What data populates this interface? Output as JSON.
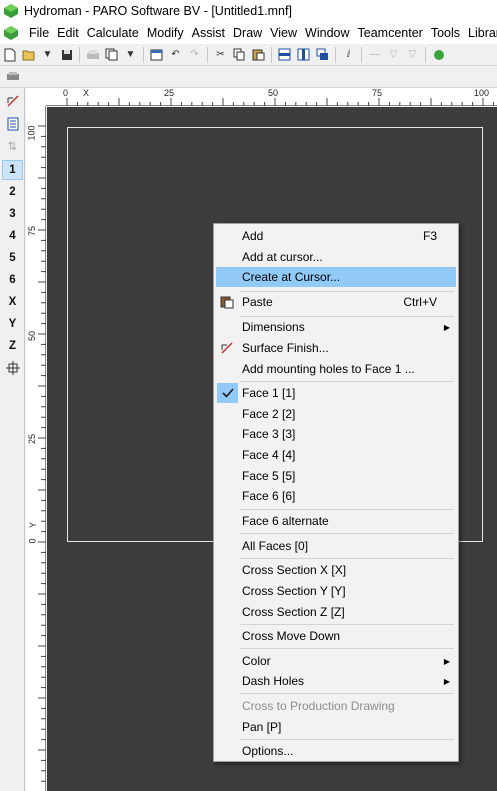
{
  "window": {
    "title": "Hydroman - PARO Software BV - [Untitled1.mnf]"
  },
  "menubar": {
    "items": [
      "File",
      "Edit",
      "Calculate",
      "Modify",
      "Assist",
      "Draw",
      "View",
      "Window",
      "Teamcenter",
      "Tools",
      "Library"
    ]
  },
  "left_panel": {
    "items": [
      "1",
      "2",
      "3",
      "4",
      "5",
      "6",
      "X",
      "Y",
      "Z"
    ],
    "selected": "1"
  },
  "ruler": {
    "top_labels": [
      "0",
      "X",
      "25",
      "50",
      "75",
      "100"
    ],
    "left_labels": [
      "100",
      "75",
      "50",
      "25",
      "0",
      "Y"
    ]
  },
  "context_menu": {
    "add": {
      "label": "Add",
      "shortcut": "F3"
    },
    "add_at_cursor": "Add at cursor...",
    "create_at_cursor": "Create at Cursor...",
    "paste": {
      "label": "Paste",
      "shortcut": "Ctrl+V"
    },
    "dimensions": "Dimensions",
    "surface_finish": "Surface Finish...",
    "add_mounting_holes": "Add mounting holes to Face 1 ...",
    "faces": [
      "Face 1  [1]",
      "Face 2  [2]",
      "Face 3  [3]",
      "Face 4  [4]",
      "Face 5  [5]",
      "Face 6  [6]"
    ],
    "face6_alternate": "Face 6 alternate",
    "all_faces": "All Faces  [0]",
    "cross_x": "Cross Section X  [X]",
    "cross_y": "Cross Section Y  [Y]",
    "cross_z": "Cross Section Z  [Z]",
    "cross_move_down": "Cross Move Down",
    "color": "Color",
    "dash_holes": "Dash Holes",
    "cross_to_production": "Cross to Production Drawing",
    "pan": "Pan  [P]",
    "options": "Options..."
  },
  "colors": {
    "canvas": "#3c3c3c",
    "highlight": "#91c9f7",
    "frame": "#e6e6e6"
  }
}
